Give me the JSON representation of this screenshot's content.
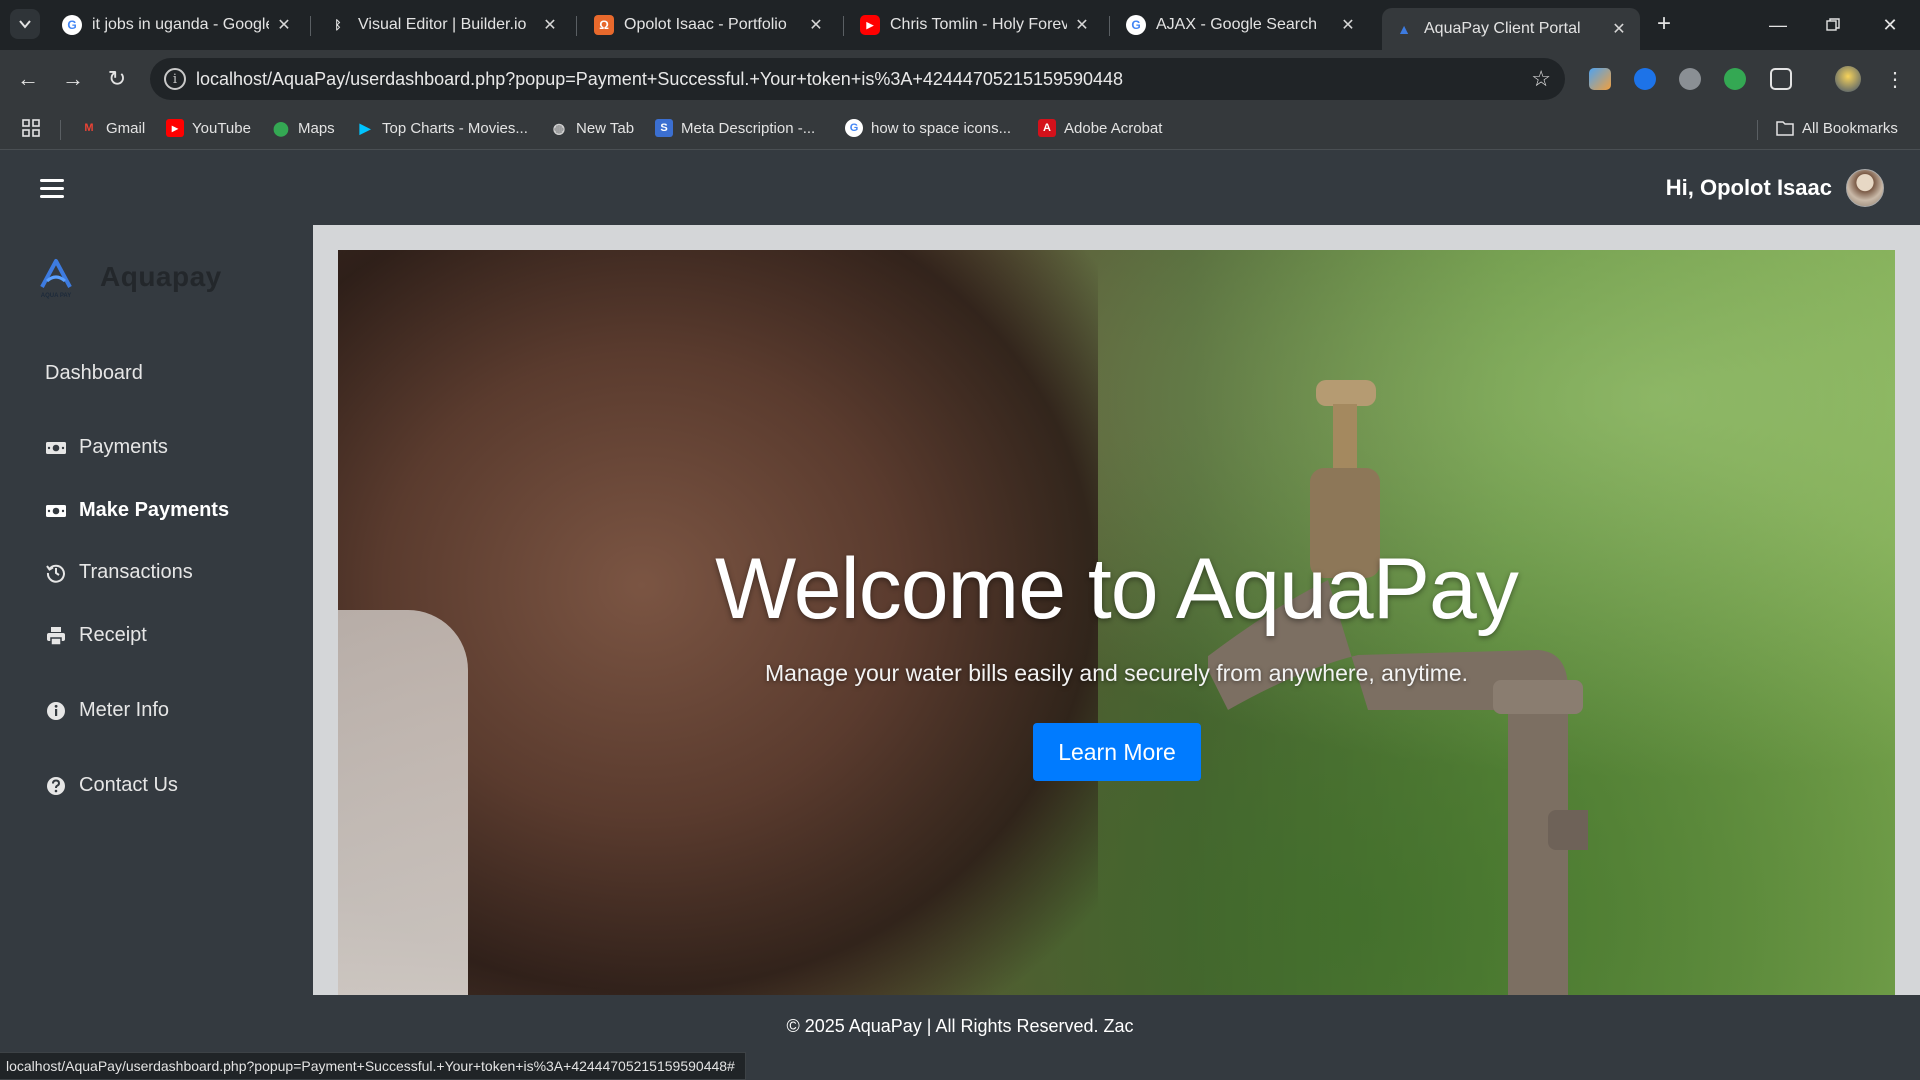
{
  "browser": {
    "tabs": [
      {
        "title": "it jobs in uganda - Google",
        "favicon": "google-icon",
        "active": false
      },
      {
        "title": "Visual Editor | Builder.io",
        "favicon": "builder-icon",
        "active": false
      },
      {
        "title": "Opolot Isaac - Portfolio",
        "favicon": "portfolio-icon",
        "active": false
      },
      {
        "title": "Chris Tomlin - Holy Forever",
        "favicon": "youtube-icon",
        "active": false
      },
      {
        "title": "AJAX - Google Search",
        "favicon": "google-icon",
        "active": false
      },
      {
        "title": "AquaPay Client Portal",
        "favicon": "aquapay-icon",
        "active": true
      }
    ],
    "url": "localhost/AquaPay/userdashboard.php?popup=Payment+Successful.+Your+token+is%3A+42444705215159590448",
    "bookmarks": [
      {
        "label": "Gmail",
        "icon": "gmail-icon"
      },
      {
        "label": "YouTube",
        "icon": "youtube-icon"
      },
      {
        "label": "Maps",
        "icon": "maps-icon"
      },
      {
        "label": "Top Charts - Movies...",
        "icon": "play-store-icon"
      },
      {
        "label": "New Tab",
        "icon": "globe-icon"
      },
      {
        "label": "Meta Description -...",
        "icon": "s-icon"
      },
      {
        "label": "how to space icons...",
        "icon": "google-icon"
      },
      {
        "label": "Adobe Acrobat",
        "icon": "acrobat-icon"
      }
    ],
    "all_bookmarks": "All Bookmarks",
    "status_url": "localhost/AquaPay/userdashboard.php?popup=Payment+Successful.+Your+token+is%3A+42444705215159590448#"
  },
  "header": {
    "greeting": "Hi, Opolot Isaac"
  },
  "sidebar": {
    "brand": "Aquapay",
    "brand_logo_caption": "AQUA PAY",
    "items": [
      {
        "label": "Dashboard",
        "icon": "",
        "active": false
      },
      {
        "label": "Payments",
        "icon": "money-bill-icon",
        "active": false
      },
      {
        "label": "Make Payments",
        "icon": "money-bill-icon",
        "active": true
      },
      {
        "label": "Transactions",
        "icon": "history-icon",
        "active": false
      },
      {
        "label": "Receipt",
        "icon": "print-icon",
        "active": false
      },
      {
        "label": "Meter Info",
        "icon": "info-circle-icon",
        "active": false
      },
      {
        "label": "Contact Us",
        "icon": "question-circle-icon",
        "active": false
      }
    ]
  },
  "hero": {
    "title": "Welcome to AquaPay",
    "subtitle": "Manage your water bills easily and securely from anywhere, anytime.",
    "button": "Learn More"
  },
  "footer": {
    "text": "© 2025 AquaPay | All Rights Reserved. Zac"
  },
  "colors": {
    "page_bg": "#343a40",
    "content_bg": "#d4d6d8",
    "primary_button": "#007bff",
    "chrome_tabstrip": "#1f2326",
    "chrome_toolbar": "#35393c"
  }
}
